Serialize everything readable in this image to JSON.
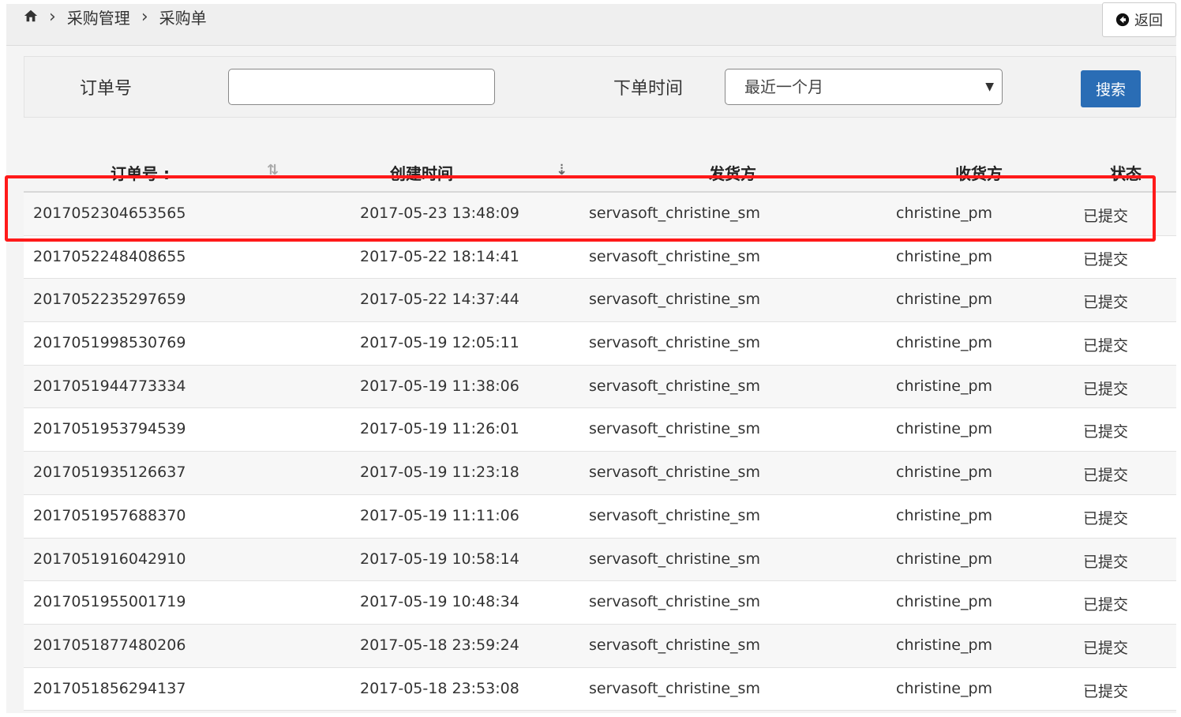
{
  "breadcrumb": {
    "home_icon": "home-icon",
    "items": [
      "采购管理",
      "采购单"
    ],
    "separator": "›"
  },
  "back_button": {
    "icon": "circle-arrow-left-icon",
    "label": "返回"
  },
  "search": {
    "order_label": "订单号",
    "order_value": "",
    "time_label": "下单时间",
    "time_selected": "最近一个月",
    "search_button": "搜索"
  },
  "table": {
    "headers": [
      "订单号 :",
      "创建时间",
      "发货方",
      "收货方",
      "状态"
    ],
    "rows": [
      [
        "2017052304653565",
        "2017-05-23 13:48:09",
        "servasoft_christine_sm",
        "christine_pm",
        "已提交"
      ],
      [
        "2017052248408655",
        "2017-05-22 18:14:41",
        "servasoft_christine_sm",
        "christine_pm",
        "已提交"
      ],
      [
        "2017052235297659",
        "2017-05-22 14:37:44",
        "servasoft_christine_sm",
        "christine_pm",
        "已提交"
      ],
      [
        "2017051998530769",
        "2017-05-19 12:05:11",
        "servasoft_christine_sm",
        "christine_pm",
        "已提交"
      ],
      [
        "2017051944773334",
        "2017-05-19 11:38:06",
        "servasoft_christine_sm",
        "christine_pm",
        "已提交"
      ],
      [
        "2017051953794539",
        "2017-05-19 11:26:01",
        "servasoft_christine_sm",
        "christine_pm",
        "已提交"
      ],
      [
        "2017051935126637",
        "2017-05-19 11:23:18",
        "servasoft_christine_sm",
        "christine_pm",
        "已提交"
      ],
      [
        "2017051957688370",
        "2017-05-19 11:11:06",
        "servasoft_christine_sm",
        "christine_pm",
        "已提交"
      ],
      [
        "2017051916042910",
        "2017-05-19 10:58:14",
        "servasoft_christine_sm",
        "christine_pm",
        "已提交"
      ],
      [
        "2017051955001719",
        "2017-05-19 10:48:34",
        "servasoft_christine_sm",
        "christine_pm",
        "已提交"
      ],
      [
        "2017051877480206",
        "2017-05-18 23:59:24",
        "servasoft_christine_sm",
        "christine_pm",
        "已提交"
      ],
      [
        "2017051856294137",
        "2017-05-18 23:53:08",
        "servasoft_christine_sm",
        "christine_pm",
        "已提交"
      ]
    ]
  },
  "colors": {
    "accent": "#2a6db5",
    "highlight": "#ff1a1a"
  }
}
